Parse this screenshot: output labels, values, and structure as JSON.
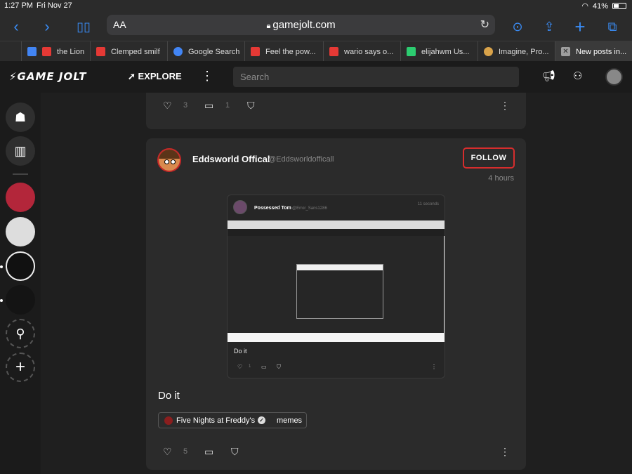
{
  "status_bar": {
    "time": "1:27 PM",
    "date": "Fri Nov 27",
    "battery": "41%"
  },
  "browser": {
    "url_host": "gamejolt.com",
    "text_size_label": "AA",
    "tabs": [
      {
        "label": "the Lion",
        "color": "#e53935"
      },
      {
        "label": "Clemped smilf",
        "color": "#e53935"
      },
      {
        "label": "Google Search",
        "color": "#4285f4"
      },
      {
        "label": "Feel the pow...",
        "color": "#e53935"
      },
      {
        "label": "wario says o...",
        "color": "#e53935"
      },
      {
        "label": "elijahwm Us...",
        "color": "#2ccc70"
      },
      {
        "label": "Imagine, Pro...",
        "color": "#d9a34a"
      },
      {
        "label": "New posts in...",
        "color": "#9e9e9e"
      }
    ]
  },
  "nav": {
    "logo": "GAME JOLT",
    "explore": "EXPLORE",
    "search_placeholder": "Search"
  },
  "prev_post": {
    "likes": "3",
    "comments": "1"
  },
  "post": {
    "author": "Eddsworld Offical",
    "handle": "@Eddsworldofficall",
    "follow_label": "FOLLOW",
    "time_ago": "4 hours",
    "text": "Do it",
    "likes": "5",
    "tags": {
      "game": "Five Nights at Freddy's",
      "channel": "memes"
    },
    "embed": {
      "author": "Possessed Tom",
      "handle": "@Error_Sans1286",
      "time": "11 seconds",
      "text": "Do it",
      "likes": "1"
    }
  }
}
